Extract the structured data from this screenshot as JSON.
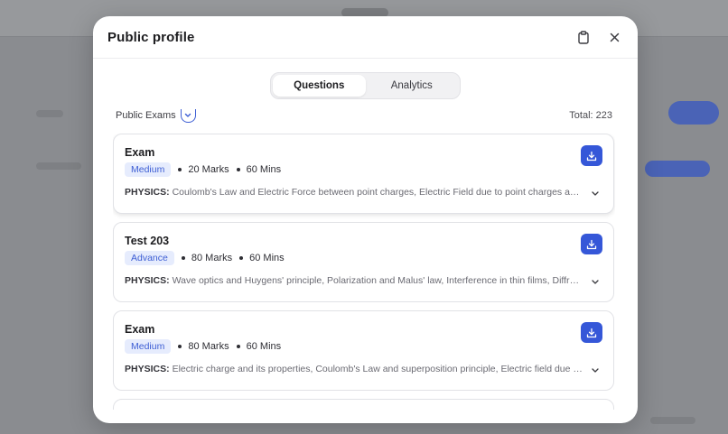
{
  "modal": {
    "title": "Public profile",
    "icons": {
      "copy": "clipboard-icon",
      "close": "close-icon"
    }
  },
  "tabs": [
    {
      "label": "Questions",
      "active": true
    },
    {
      "label": "Analytics",
      "active": false
    }
  ],
  "filter": {
    "label": "Public Exams",
    "total_label": "Total: 223"
  },
  "exams": [
    {
      "title": "Exam",
      "level": "Medium",
      "marks": "20 Marks",
      "duration": "60 Mins",
      "subject": "PHYSICS:",
      "topics": "Coulomb's Law and Electric Force between point charges, Electric Field due to point charges and continuous charge distributions"
    },
    {
      "title": "Test 203",
      "level": "Advance",
      "marks": "80 Marks",
      "duration": "60 Mins",
      "subject": "PHYSICS:",
      "topics": "Wave optics and Huygens' principle, Polarization and Malus' law, Interference in thin films, Diffraction"
    },
    {
      "title": "Exam",
      "level": "Medium",
      "marks": "80 Marks",
      "duration": "60 Mins",
      "subject": "PHYSICS:",
      "topics": "Electric charge and its properties, Coulomb's Law and superposition principle, Electric field due to a dipole"
    }
  ],
  "colors": {
    "accent": "#3557d8",
    "badge_bg": "#e6ecfd"
  }
}
